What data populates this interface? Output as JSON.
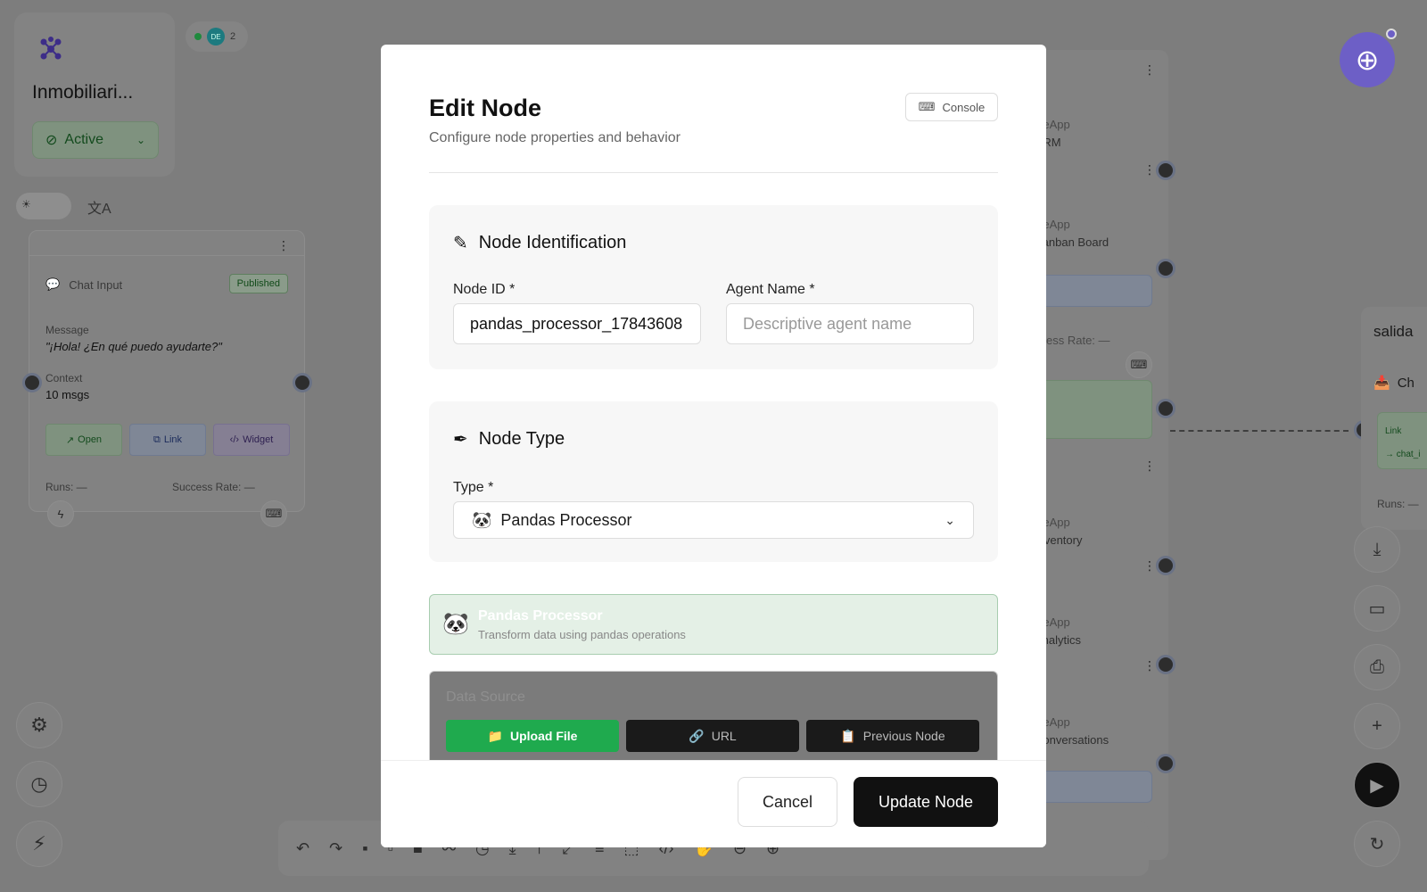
{
  "app": {
    "name": "Inmobiliari...",
    "status": "Active"
  },
  "presence": {
    "initials": "DE",
    "count": "2"
  },
  "chat_node": {
    "title": "Chat Input",
    "badge": "Published",
    "message_label": "Message",
    "message_value": "\"¡Hola! ¿En qué puedo ayudarte?\"",
    "context_label": "Context",
    "context_value": "10 msgs",
    "buttons": {
      "open": "Open",
      "link": "Link",
      "widget": "Widget"
    },
    "runs": "Runs: —",
    "success_rate": "Success Rate: —"
  },
  "right_nodes": [
    {
      "app": "iveApp",
      "name": "CRM"
    },
    {
      "app": "iveApp",
      "name": "Kanban Board"
    },
    {
      "app": "",
      "name": "ccess Rate: —"
    },
    {
      "app": "iveApp",
      "name": "Inventory"
    },
    {
      "app": "iveApp",
      "name": "Analytics"
    },
    {
      "app": "iveApp",
      "name": "Conversations"
    }
  ],
  "salida": {
    "title": "salida",
    "ch": "Ch",
    "link": "Link",
    "chat": "→ chat_i",
    "runs": "Runs: —"
  },
  "modal": {
    "title": "Edit Node",
    "subtitle": "Configure node properties and behavior",
    "console_label": "Console",
    "identification": {
      "heading": "Node Identification",
      "node_id_label": "Node ID *",
      "node_id_value": "pandas_processor_17843608",
      "agent_name_label": "Agent Name *",
      "agent_name_placeholder": "Descriptive agent name"
    },
    "node_type": {
      "heading": "Node Type",
      "type_label": "Type *",
      "selected": "Pandas Processor"
    },
    "info": {
      "title": "Pandas Processor",
      "description": "Transform data using pandas operations"
    },
    "data_source": {
      "heading": "Data Source",
      "upload": "Upload File",
      "url": "URL",
      "previous": "Previous Node"
    },
    "cancel": "Cancel",
    "update": "Update Node"
  },
  "colors": {
    "accent": "#6d5fc6",
    "success": "#1faa4e",
    "primary_button": "#111111"
  }
}
